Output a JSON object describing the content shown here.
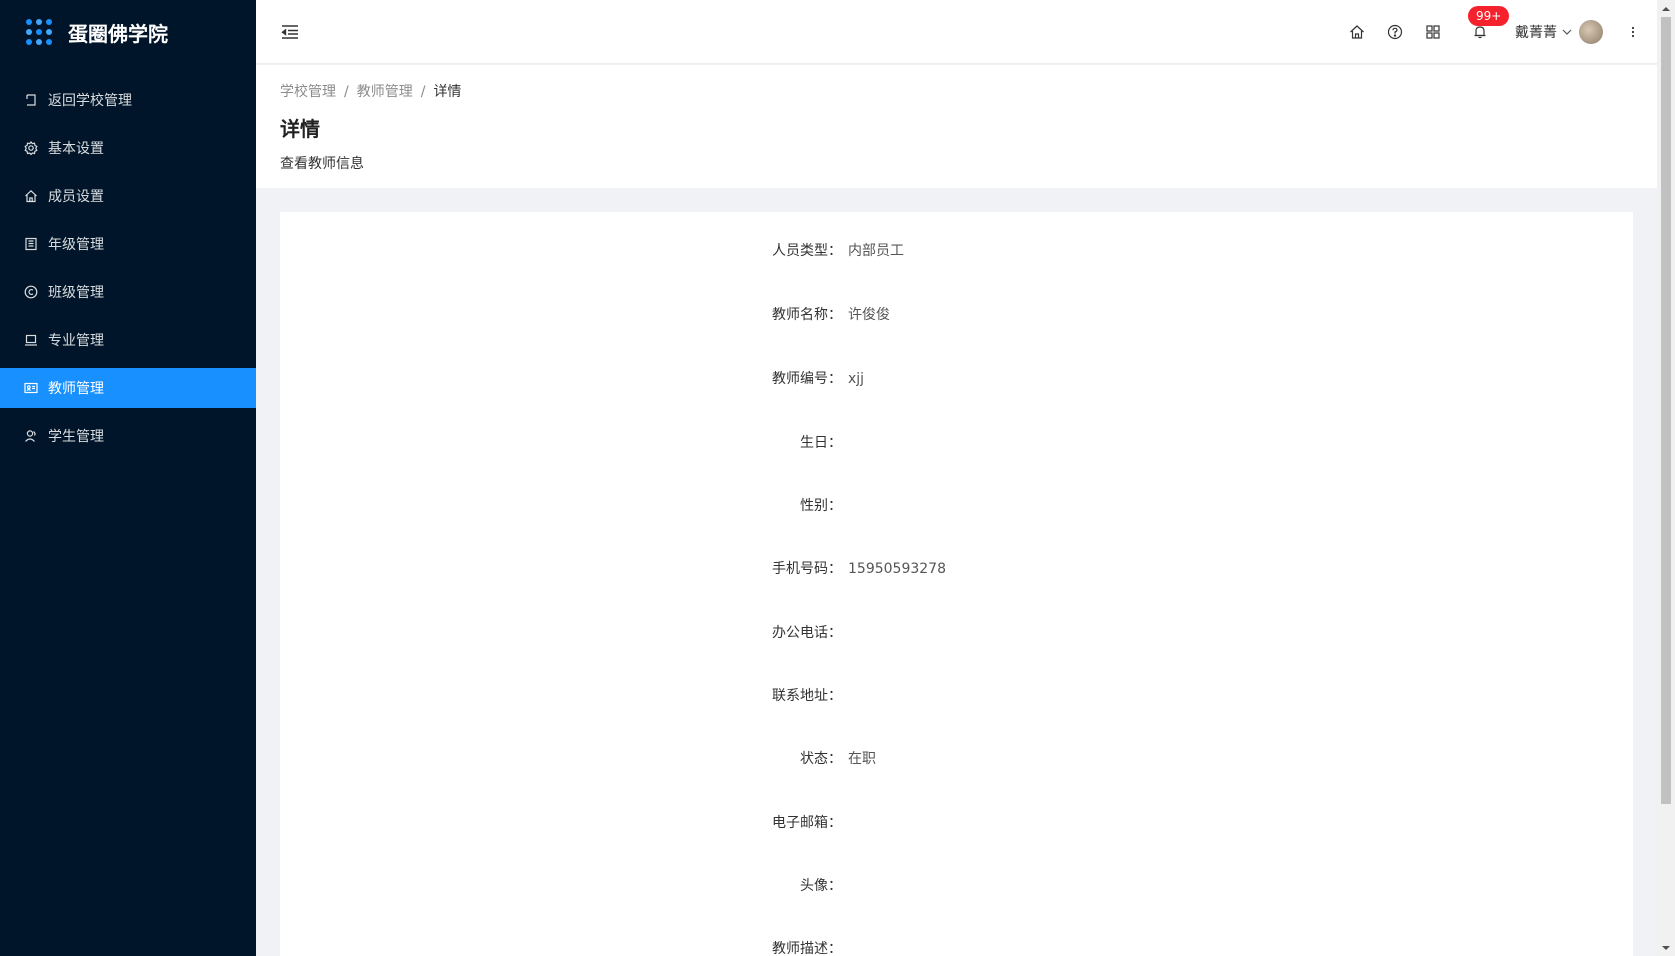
{
  "app": {
    "title": "蛋圈佛学院"
  },
  "sidebar": {
    "items": [
      {
        "label": "返回学校管理",
        "icon": "back-icon",
        "active": false
      },
      {
        "label": "基本设置",
        "icon": "gear-icon",
        "active": false
      },
      {
        "label": "成员设置",
        "icon": "home-icon",
        "active": false
      },
      {
        "label": "年级管理",
        "icon": "building-icon",
        "active": false
      },
      {
        "label": "班级管理",
        "icon": "copyright-icon",
        "active": false
      },
      {
        "label": "专业管理",
        "icon": "laptop-icon",
        "active": false
      },
      {
        "label": "教师管理",
        "icon": "id-card-icon",
        "active": true
      },
      {
        "label": "学生管理",
        "icon": "users-icon",
        "active": false
      }
    ]
  },
  "header": {
    "notification_count": "99+",
    "user_name": "戴菁菁"
  },
  "breadcrumb": [
    "学校管理",
    "教师管理",
    "详情"
  ],
  "page": {
    "title": "详情",
    "description": "查看教师信息"
  },
  "fields": [
    {
      "label": "人员类型：",
      "value": "内部员工"
    },
    {
      "label": "教师名称：",
      "value": "许俊俊"
    },
    {
      "label": "教师编号：",
      "value": "xjj"
    },
    {
      "label": "生日：",
      "value": ""
    },
    {
      "label": "性别：",
      "value": ""
    },
    {
      "label": "手机号码：",
      "value": "15950593278"
    },
    {
      "label": "办公电话：",
      "value": ""
    },
    {
      "label": "联系地址：",
      "value": ""
    },
    {
      "label": "状态：",
      "value": "在职"
    },
    {
      "label": "电子邮箱：",
      "value": ""
    },
    {
      "label": "头像：",
      "value": ""
    },
    {
      "label": "教师描述：",
      "value": ""
    }
  ],
  "colors": {
    "sidebar_bg": "#001529",
    "accent": "#1890ff",
    "badge": "#f5222d"
  }
}
